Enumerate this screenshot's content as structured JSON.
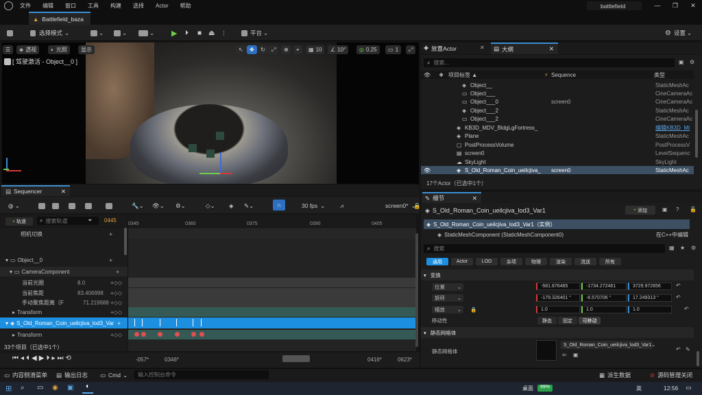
{
  "menubar": {
    "items": [
      "文件",
      "编辑",
      "窗口",
      "工具",
      "构建",
      "选择",
      "Actor",
      "帮助"
    ],
    "project": "battlefield"
  },
  "tabs": {
    "doc": "Battlefield_baza"
  },
  "toolbar": {
    "select_mode": "选择模式",
    "platform": "平台",
    "settings": "设置"
  },
  "viewport": {
    "perspective": "透视",
    "lit": "光照",
    "show": "显示",
    "camera_label": "[ 驾驶激活 - Object__0 ]",
    "grid": "10",
    "angle": "10°",
    "scale": "0.25",
    "cams": "1"
  },
  "sequencer": {
    "tab": "Sequencer",
    "fps": "30 fps",
    "seq_name": "screen0*",
    "add_track": "轨道",
    "search_placeholder": "搜索轨道",
    "frame": "0445",
    "ticks": [
      "0345",
      "0360",
      "0375",
      "0390",
      "0405"
    ],
    "tracks": [
      "相机切换",
      "Object__0",
      "CameraComponent",
      "当前光圈",
      "当前焦距",
      "手动聚焦距离（F",
      "Transform",
      "S_Old_Roman_Coin_ueilcjiva_lod3_Var",
      "Transform"
    ],
    "values": {
      "aperture": "8.0",
      "focal": "83.406998",
      "focus": "71.219688"
    },
    "count": "33个项目（已选中1个）",
    "range_start": "-057*",
    "range_in": "0346*",
    "range_out": "0416*",
    "range_end": "0623*"
  },
  "outliner": {
    "tab_place": "放置Actor",
    "tab_outliner": "大纲",
    "search_placeholder": "搜索...",
    "col_label": "项目标签 ▲",
    "col_seq": "Sequence",
    "col_type": "类型",
    "rows": [
      {
        "name": "Object__",
        "seq": "",
        "type": "StaticMeshAc"
      },
      {
        "name": "Object___",
        "seq": "",
        "type": "CineCameraAc"
      },
      {
        "name": "Object___0",
        "seq": "screen0",
        "type": "CineCameraAc"
      },
      {
        "name": "Object___2",
        "seq": "",
        "type": "StaticMeshAc"
      },
      {
        "name": "Object___2",
        "seq": "",
        "type": "CineCameraAc"
      },
      {
        "name": "KB3D_MDV_BldgLgFortress_",
        "seq": "",
        "type": "编辑KB3D_MI"
      },
      {
        "name": "Plane",
        "seq": "",
        "type": "StaticMeshAc"
      },
      {
        "name": "PostProcessVolume",
        "seq": "",
        "type": "PostProcessV"
      },
      {
        "name": "screen0",
        "seq": "",
        "type": "LevelSequenc"
      },
      {
        "name": "SkyLight",
        "seq": "",
        "type": "SkyLight"
      },
      {
        "name": "S_Old_Roman_Coin_ueilcjiva_",
        "seq": "screen0",
        "type": "StaticMeshAc"
      }
    ],
    "count": "17个Actor（已选中1个）"
  },
  "details": {
    "tab": "细节",
    "actor": "S_Old_Roman_Coin_ueilcjiva_lod3_Var1",
    "add": "添加",
    "instance": "S_Old_Roman_Coin_ueilcjiva_lod3_Var1（实例）",
    "component": "StaticMeshComponent (StaticMeshComponent0)",
    "edit_cpp": "在C++中编辑",
    "search_placeholder": "搜索",
    "filters": [
      "通用",
      "Actor",
      "LOD",
      "杂项",
      "物理",
      "渲染",
      "流送",
      "所有"
    ],
    "transform_header": "变换",
    "location": {
      "label": "位置",
      "x": "-581.876465",
      "y": "-1734.272461",
      "z": "3729.972656"
    },
    "rotation": {
      "label": "旋转",
      "x": "-179.326401 °",
      "y": "-6.570706 °",
      "z": "17.249313 °"
    },
    "scale": {
      "label": "缩放",
      "x": "1.0",
      "y": "1.0",
      "z": "1.0"
    },
    "mobility": {
      "label": "移动性",
      "static": "静态",
      "fixed": "固定",
      "movable": "可移动"
    },
    "mesh_header": "静态网格体",
    "mesh_label": "静态网格体",
    "mesh_value": "S_Old_Roman_Coin_ueilcjiva_lod3_Var1"
  },
  "status": {
    "content": "内容侧滑菜单",
    "log": "输出日志",
    "cmd": "Cmd",
    "cmd_placeholder": "输入控制台命令",
    "derived": "派生数据",
    "source": "源码管理关闭"
  },
  "taskbar": {
    "desktop": "桌面",
    "battery": "99%",
    "ime": "英",
    "time": "12:56"
  }
}
